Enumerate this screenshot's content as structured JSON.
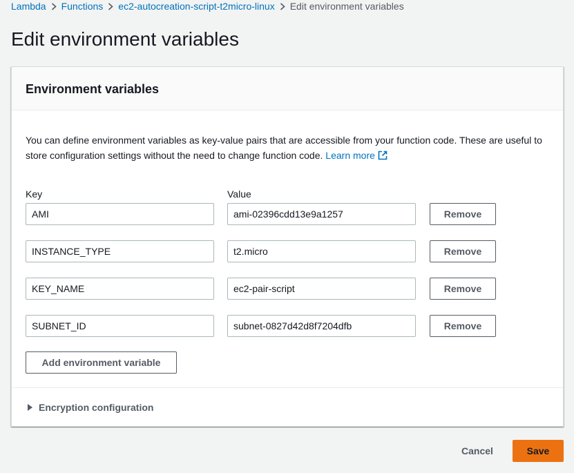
{
  "breadcrumb": {
    "items": [
      "Lambda",
      "Functions",
      "ec2-autocreation-script-t2micro-linux"
    ],
    "current": "Edit environment variables"
  },
  "page": {
    "title": "Edit environment variables"
  },
  "panel": {
    "title": "Environment variables",
    "description": "You can define environment variables as key-value pairs that are accessible from your function code. These are useful to store configuration settings without the need to change function code.",
    "learn_more": "Learn more",
    "key_label": "Key",
    "value_label": "Value",
    "variables": [
      {
        "key": "AMI",
        "value": "ami-02396cdd13e9a1257"
      },
      {
        "key": "INSTANCE_TYPE",
        "value": "t2.micro"
      },
      {
        "key": "KEY_NAME",
        "value": "ec2-pair-script"
      },
      {
        "key": "SUBNET_ID",
        "value": "subnet-0827d42d8f7204dfb"
      }
    ],
    "remove_label": "Remove",
    "add_label": "Add environment variable",
    "encryption_label": "Encryption configuration"
  },
  "footer": {
    "cancel_label": "Cancel",
    "save_label": "Save"
  },
  "colors": {
    "link": "#0073bb",
    "primary": "#ec7211",
    "background": "#f2f3f3"
  }
}
